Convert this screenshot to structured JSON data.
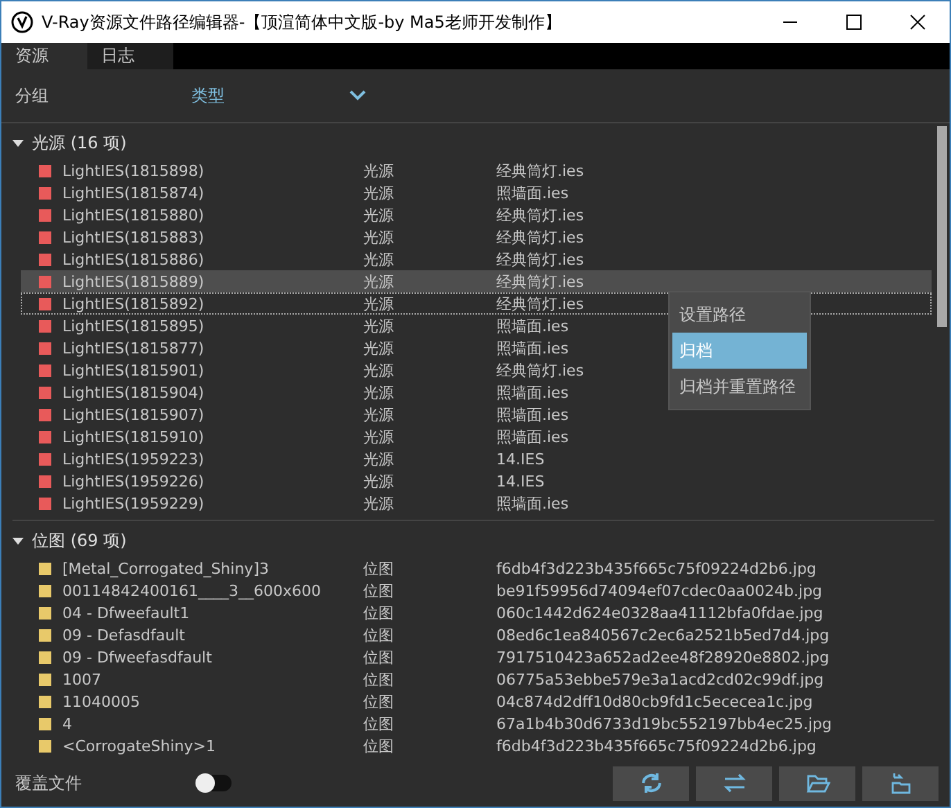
{
  "window": {
    "title": "V-Ray资源文件路径编辑器-【顶渲简体中文版-by Ma5老师开发制作】"
  },
  "tabs": [
    {
      "label": "资源",
      "selected": true
    },
    {
      "label": "日志",
      "selected": false
    }
  ],
  "grouping": {
    "label": "分组",
    "value": "类型"
  },
  "groups": [
    {
      "title": "光源 (16 项)",
      "expanded": true,
      "color": "#e85a5a",
      "rows": [
        {
          "name": "LightIES(1815898)",
          "type": "光源",
          "file": "经典筒灯.ies",
          "selected": false,
          "focused": false
        },
        {
          "name": "LightIES(1815874)",
          "type": "光源",
          "file": "照墙面.ies",
          "selected": false,
          "focused": false
        },
        {
          "name": "LightIES(1815880)",
          "type": "光源",
          "file": "经典筒灯.ies",
          "selected": false,
          "focused": false
        },
        {
          "name": "LightIES(1815883)",
          "type": "光源",
          "file": "经典筒灯.ies",
          "selected": false,
          "focused": false
        },
        {
          "name": "LightIES(1815886)",
          "type": "光源",
          "file": "经典筒灯.ies",
          "selected": false,
          "focused": false
        },
        {
          "name": "LightIES(1815889)",
          "type": "光源",
          "file": "经典筒灯.ies",
          "selected": true,
          "focused": false
        },
        {
          "name": "LightIES(1815892)",
          "type": "光源",
          "file": "经典筒灯.ies",
          "selected": false,
          "focused": true
        },
        {
          "name": "LightIES(1815895)",
          "type": "光源",
          "file": "照墙面.ies",
          "selected": false,
          "focused": false
        },
        {
          "name": "LightIES(1815877)",
          "type": "光源",
          "file": "照墙面.ies",
          "selected": false,
          "focused": false
        },
        {
          "name": "LightIES(1815901)",
          "type": "光源",
          "file": "经典筒灯.ies",
          "selected": false,
          "focused": false
        },
        {
          "name": "LightIES(1815904)",
          "type": "光源",
          "file": "照墙面.ies",
          "selected": false,
          "focused": false
        },
        {
          "name": "LightIES(1815907)",
          "type": "光源",
          "file": "照墙面.ies",
          "selected": false,
          "focused": false
        },
        {
          "name": "LightIES(1815910)",
          "type": "光源",
          "file": "照墙面.ies",
          "selected": false,
          "focused": false
        },
        {
          "name": "LightIES(1959223)",
          "type": "光源",
          "file": "14.IES",
          "selected": false,
          "focused": false
        },
        {
          "name": "LightIES(1959226)",
          "type": "光源",
          "file": "14.IES",
          "selected": false,
          "focused": false
        },
        {
          "name": "LightIES(1959229)",
          "type": "光源",
          "file": "照墙面.ies",
          "selected": false,
          "focused": false
        }
      ]
    },
    {
      "title": "位图 (69 项)",
      "expanded": true,
      "color": "#e8c96a",
      "rows": [
        {
          "name": "[Metal_Corrogated_Shiny]3",
          "type": "位图",
          "file": "f6db4f3d223b435f665c75f09224d2b6.jpg",
          "selected": false,
          "focused": false
        },
        {
          "name": "00114842400161____3__600x600",
          "type": "位图",
          "file": "be91f59956d74094ef07cdec0aa0024b.jpg",
          "selected": false,
          "focused": false
        },
        {
          "name": "04 - Dfweefault1",
          "type": "位图",
          "file": "060c1442d624e0328aa41112bfa0fdae.jpg",
          "selected": false,
          "focused": false
        },
        {
          "name": "09 - Defasdfault",
          "type": "位图",
          "file": "08ed6c1ea840567c2ec6a2521b5ed7d4.jpg",
          "selected": false,
          "focused": false
        },
        {
          "name": "09 - Dfweefasdfault",
          "type": "位图",
          "file": "7917510423a652ad2ee48f28920e8802.jpg",
          "selected": false,
          "focused": false
        },
        {
          "name": "1007",
          "type": "位图",
          "file": "06775a53ebbe579e3a1acd2cd02c99df.jpg",
          "selected": false,
          "focused": false
        },
        {
          "name": "11040005",
          "type": "位图",
          "file": "04c874d2dff10d80cb9fd1c5ececea1c.jpg",
          "selected": false,
          "focused": false
        },
        {
          "name": "4",
          "type": "位图",
          "file": "67a1b4b30d6733d19bc552197bb4ec25.jpg",
          "selected": false,
          "focused": false
        },
        {
          "name": "<CorrogateShiny>1",
          "type": "位图",
          "file": "f6db4f3d223b435f665c75f09224d2b6.jpg",
          "selected": false,
          "focused": false
        }
      ]
    }
  ],
  "context_menu": [
    {
      "label": "设置路径",
      "selected": false
    },
    {
      "label": "归档",
      "selected": true
    },
    {
      "label": "归档并重置路径",
      "selected": false
    }
  ],
  "footer": {
    "overwrite_label": "覆盖文件",
    "overwrite_on": false,
    "buttons": [
      {
        "kind": "refresh"
      },
      {
        "kind": "swap"
      },
      {
        "kind": "open"
      },
      {
        "kind": "relocate"
      }
    ]
  }
}
